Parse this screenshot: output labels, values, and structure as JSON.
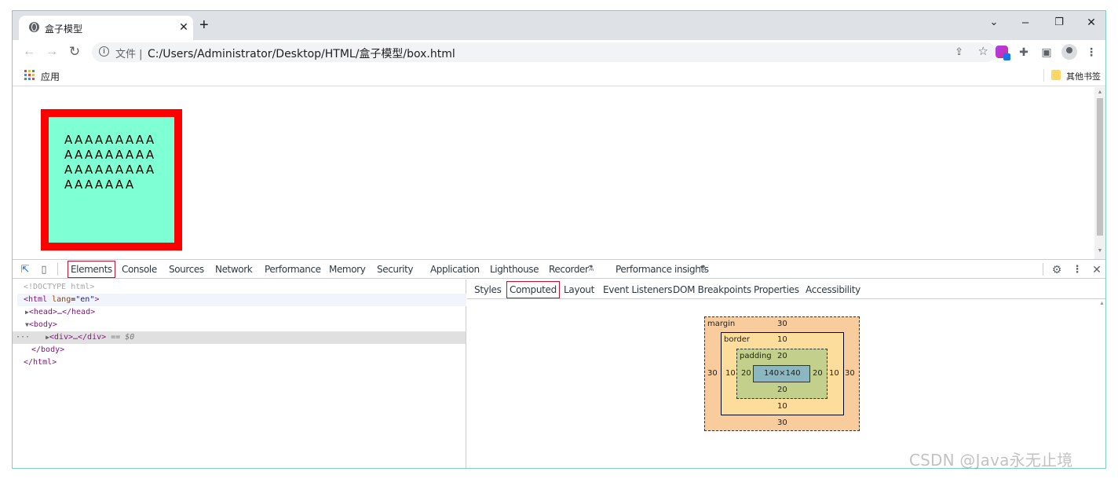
{
  "browser": {
    "tab_title": "盒子模型",
    "tab_close": "✕",
    "new_tab": "+",
    "window_controls": {
      "minimize": "–",
      "restore": "❐",
      "close": "✕",
      "dropdown": "⌄"
    },
    "nav": {
      "back": "←",
      "forward": "→",
      "reload": "↻"
    },
    "omnibox": {
      "info_icon": "i",
      "chip": "文件 |",
      "url": "C:/Users/Administrator/Desktop/HTML/盒子模型/box.html"
    },
    "bookmarks": {
      "apps_label": "应用",
      "other_label": "其他书签"
    },
    "toolbar_icons": [
      "share-icon",
      "star-icon",
      "extension-color-icon",
      "puzzle-icon",
      "side-panel-icon",
      "profile-avatar",
      "kebab-menu-icon"
    ]
  },
  "page": {
    "box_text": "AAAAAAAAAAAAAAAAAAAAAAAAAAAAAAAAAA",
    "box_colors": {
      "background": "#7fffd4",
      "border": "#ff0000"
    }
  },
  "devtools": {
    "tabs": [
      "Elements",
      "Console",
      "Sources",
      "Network",
      "Performance",
      "Memory",
      "Security",
      "Application",
      "Lighthouse",
      "Recorder",
      "Performance insights"
    ],
    "active_tab": "Elements",
    "elements": {
      "doctype": "<!DOCTYPE html>",
      "html_open": "<html",
      "lang_attr": "lang",
      "lang_val": "\"en\"",
      "html_close_bracket": ">",
      "head": "<head>…</head>",
      "body_open": "<body>",
      "div": "<div>…</div>",
      "div_suffix": " == $0",
      "ellipsis": "···",
      "body_close": "</body>",
      "html_close": "</html>"
    },
    "side_tabs": [
      "Styles",
      "Computed",
      "Layout",
      "Event Listeners",
      "DOM Breakpoints",
      "Properties",
      "Accessibility"
    ],
    "active_side_tab": "Computed",
    "box_model": {
      "margin_label": "margin",
      "border_label": "border",
      "padding_label": "padding",
      "margin": {
        "top": "30",
        "right": "30",
        "bottom": "30",
        "left": "30"
      },
      "border": {
        "top": "10",
        "right": "10",
        "bottom": "10",
        "left": "10"
      },
      "padding": {
        "top": "20",
        "right": "20",
        "bottom": "20",
        "left": "20"
      },
      "content": "140×140"
    }
  },
  "watermark": "CSDN @Java永无止境"
}
